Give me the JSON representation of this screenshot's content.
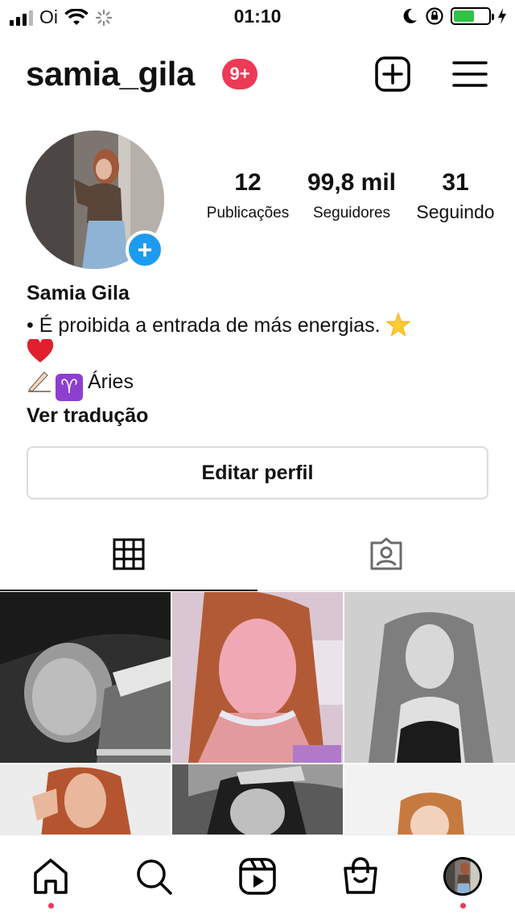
{
  "status_bar": {
    "carrier": "Oi",
    "time": "01:10"
  },
  "header": {
    "username": "samia_gila",
    "notification_badge": "9+"
  },
  "profile": {
    "stats": [
      {
        "value": "12",
        "label": "Publicações"
      },
      {
        "value": "99,8 mil",
        "label": "Seguidores"
      },
      {
        "value": "31",
        "label": "Seguindo"
      }
    ],
    "display_name": "Samia Gila",
    "bio_line1": "• É proibida a entrada de más energias.",
    "bio_line3_text": "Áries",
    "translate_link": "Ver tradução",
    "edit_button": "Editar perfil"
  },
  "colors": {
    "badge": "#ed3a56",
    "add_story": "#1d9bf0",
    "battery": "#32c244"
  },
  "tabs": [
    {
      "icon": "grid-icon",
      "active": true
    },
    {
      "icon": "tagged-person-icon",
      "active": false
    }
  ],
  "bottom_nav": [
    {
      "icon": "home-icon",
      "badge_dot": true
    },
    {
      "icon": "search-icon",
      "badge_dot": false
    },
    {
      "icon": "reels-icon",
      "badge_dot": false
    },
    {
      "icon": "shop-icon",
      "badge_dot": false
    },
    {
      "icon": "profile-avatar",
      "badge_dot": true
    }
  ]
}
